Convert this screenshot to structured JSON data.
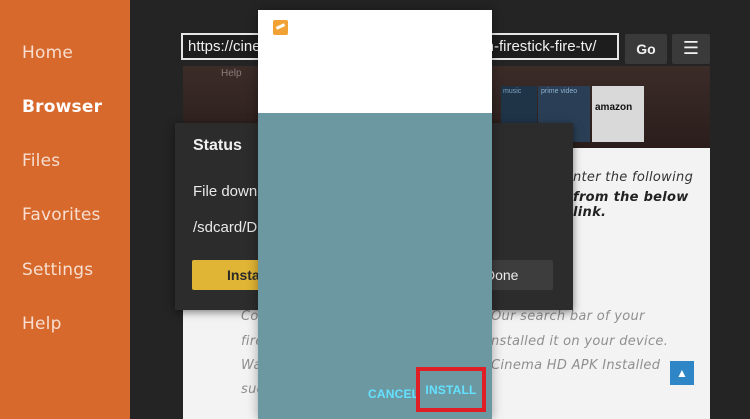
{
  "sidebar": {
    "items": [
      {
        "label": "Home"
      },
      {
        "label": "Browser"
      },
      {
        "label": "Files"
      },
      {
        "label": "Favorites"
      },
      {
        "label": "Settings"
      },
      {
        "label": "Help"
      }
    ],
    "active_index": 1,
    "color": "#d8692c"
  },
  "browser": {
    "url": "https://cinemahdapk.com/install-cinema-hd-on-firestick-fire-tv/",
    "go_label": "Go",
    "menu_icon": "hamburger-icon"
  },
  "web_page": {
    "hero_help": "Help",
    "hero_amazon": "amazon",
    "hero_music": "music",
    "hero_prime": "prime video",
    "lines": [
      "nter the following",
      "from the below link.",
      "Our search bar of your",
      "nstalled it on your device.",
      "Cinema HD APK Installed"
    ],
    "left_fragments": [
      "Co",
      "fire",
      "Wa",
      "suc"
    ]
  },
  "status_dialog": {
    "title": "Status",
    "message": "File downl",
    "path": "/sdcard/D",
    "install_label": "Insta",
    "done_label": "Done"
  },
  "installer": {
    "cancel_label": "CANCEL",
    "install_label": "INSTALL",
    "accent": "#65e1ff",
    "highlight_color": "#df1f25"
  }
}
